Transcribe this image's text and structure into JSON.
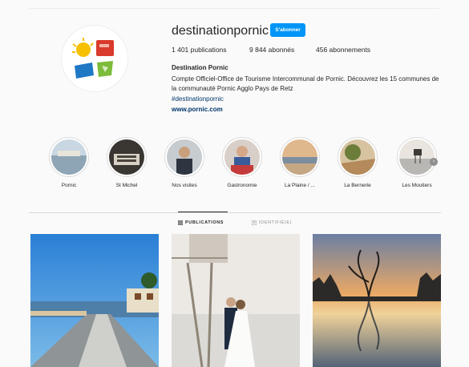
{
  "profile": {
    "username": "destinationpornic",
    "follow_label": "S'abonner",
    "stats": {
      "publications": "1 401 publications",
      "abonnes": "9 844 abonnés",
      "abonnements": "456 abonnements"
    },
    "bio": {
      "name": "Destination Pornic",
      "text": "Compte Officiel-Office de Tourisme Intercommunal de Pornic. Découvrez les 15 communes de la communauté Pornic Agglo Pays de Retz",
      "hashtag": "#destinationpornic",
      "link": "www.pornic.com"
    },
    "avatar_icon": "destination-pornic-logo"
  },
  "highlights": [
    {
      "label": "Pornic"
    },
    {
      "label": "St Michel"
    },
    {
      "label": "Nos visites"
    },
    {
      "label": "Gastronomie"
    },
    {
      "label": "La Plaine / ..."
    },
    {
      "label": "La Bernerie"
    },
    {
      "label": "Les Moutiers"
    }
  ],
  "tabs": {
    "publications": "PUBLICATIONS",
    "identifie": "IDENTIFIÉ(E)"
  },
  "colors": {
    "accent": "#0095f6",
    "link": "#00376b",
    "background": "#fafafa"
  }
}
